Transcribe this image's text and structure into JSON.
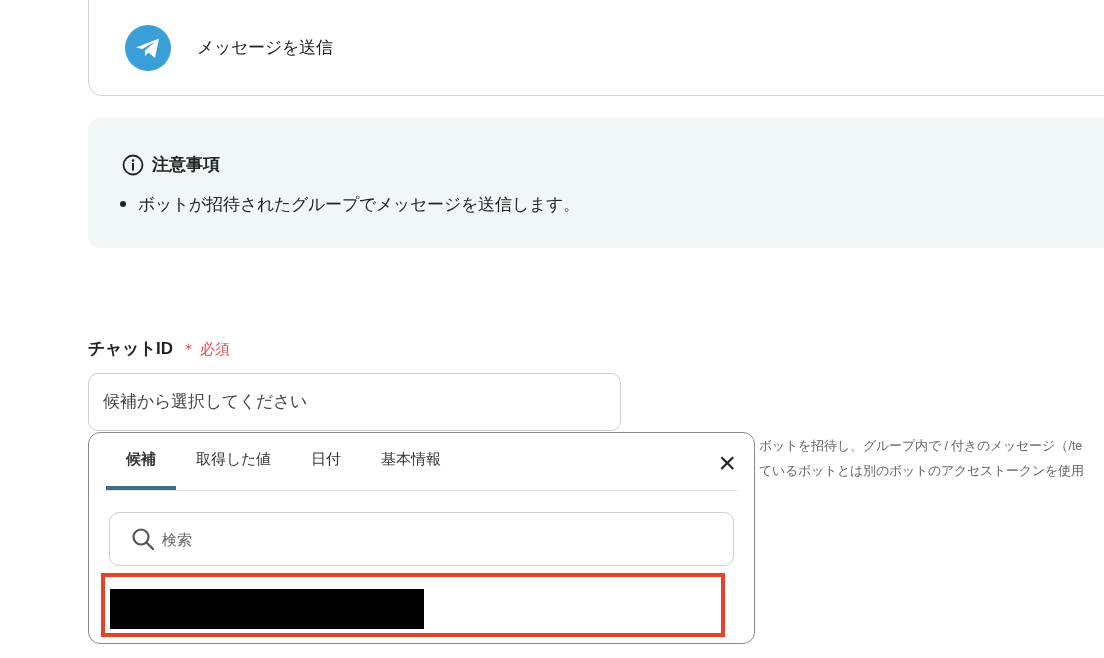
{
  "action_card": {
    "label": "メッセージを送信"
  },
  "notice": {
    "title": "注意事項",
    "items": [
      "ボットが招待されたグループでメッセージを送信します。"
    ]
  },
  "chat_id_field": {
    "label": "チャットID",
    "required_mark": "＊",
    "required_label": "必須",
    "placeholder": "候補から選択してください",
    "help_lines": [
      "ボットを招待し、グループ内で / 付きのメッセージ（/te",
      "ているボットとは別のボットのアクセストークンを使用"
    ]
  },
  "dropdown": {
    "tabs": [
      {
        "label": "候補",
        "selected": true
      },
      {
        "label": "取得した値",
        "selected": false
      },
      {
        "label": "日付",
        "selected": false
      },
      {
        "label": "基本情報",
        "selected": false
      }
    ],
    "close": "×",
    "search": {
      "placeholder": "検索"
    },
    "options": [
      {
        "kind": "redacted",
        "highlighted": true
      }
    ]
  }
}
